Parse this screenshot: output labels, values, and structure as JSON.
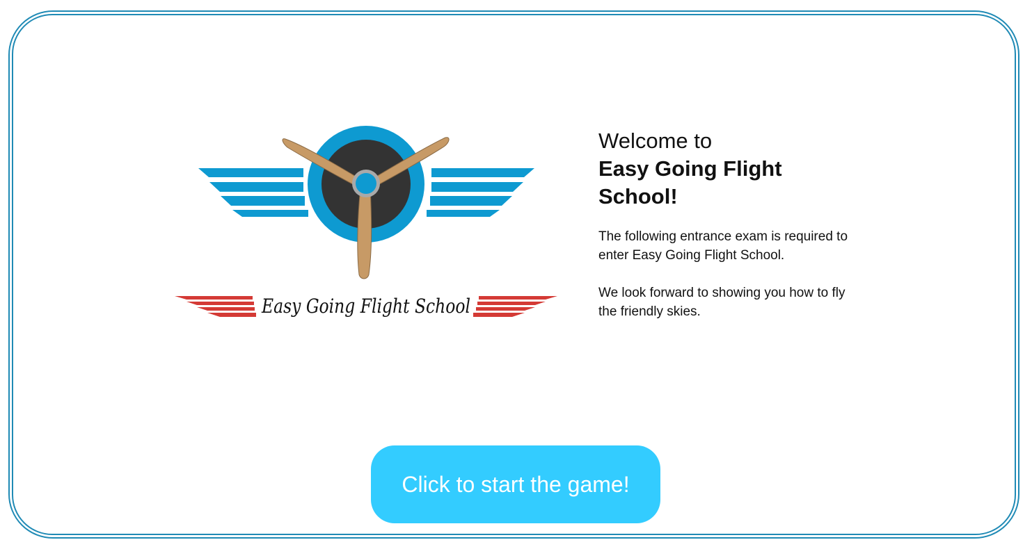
{
  "welcome": {
    "intro": "Welcome to",
    "school_name": "Easy Going Flight School!",
    "paragraph1": "The following entrance exam is required to enter Easy Going Flight School.",
    "paragraph2": "We look forward to showing you how to fly the friendly skies."
  },
  "logo": {
    "text": "Easy Going Flight School",
    "icon": "propeller-wings-logo",
    "colors": {
      "wings": "#0e9ad1",
      "propeller": "#c79a66",
      "hub": "#333333",
      "stripes": "#d43a35"
    }
  },
  "start_button": {
    "label": "Click to start the game!",
    "color": "#33ccff"
  },
  "frame": {
    "border_color": "#1f8ab5"
  }
}
